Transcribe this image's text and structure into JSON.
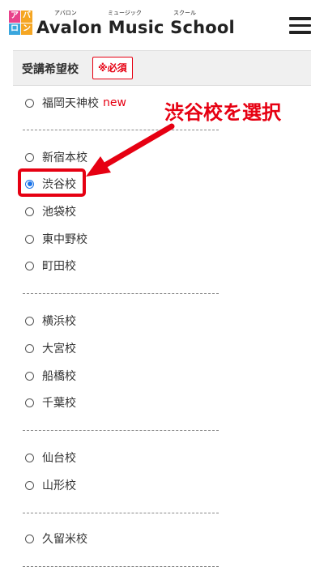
{
  "header": {
    "logo_chars": [
      "ア",
      "バ",
      "ロ",
      "ン"
    ],
    "logo_colors": [
      "#e8428c",
      "#f5a623",
      "#3aa6dd",
      "#f5a623"
    ],
    "title": "Avalon Music School",
    "ruby": {
      "avalon": "アバロン",
      "music": "ミュージック",
      "school": "スクール"
    }
  },
  "section": {
    "title": "受講希望校",
    "required_label": "※必須"
  },
  "schools": [
    {
      "label": "福岡天神校",
      "badge": "new",
      "checked": false
    },
    {
      "label": "新宿本校",
      "checked": false
    },
    {
      "label": "渋谷校",
      "checked": true
    },
    {
      "label": "池袋校",
      "checked": false
    },
    {
      "label": "東中野校",
      "checked": false
    },
    {
      "label": "町田校",
      "checked": false
    },
    {
      "label": "横浜校",
      "checked": false
    },
    {
      "label": "大宮校",
      "checked": false
    },
    {
      "label": "船橋校",
      "checked": false
    },
    {
      "label": "千葉校",
      "checked": false
    },
    {
      "label": "仙台校",
      "checked": false
    },
    {
      "label": "山形校",
      "checked": false
    },
    {
      "label": "久留米校",
      "checked": false
    }
  ],
  "annotation": {
    "text": "渋谷校を選択",
    "color": "#e60012"
  }
}
